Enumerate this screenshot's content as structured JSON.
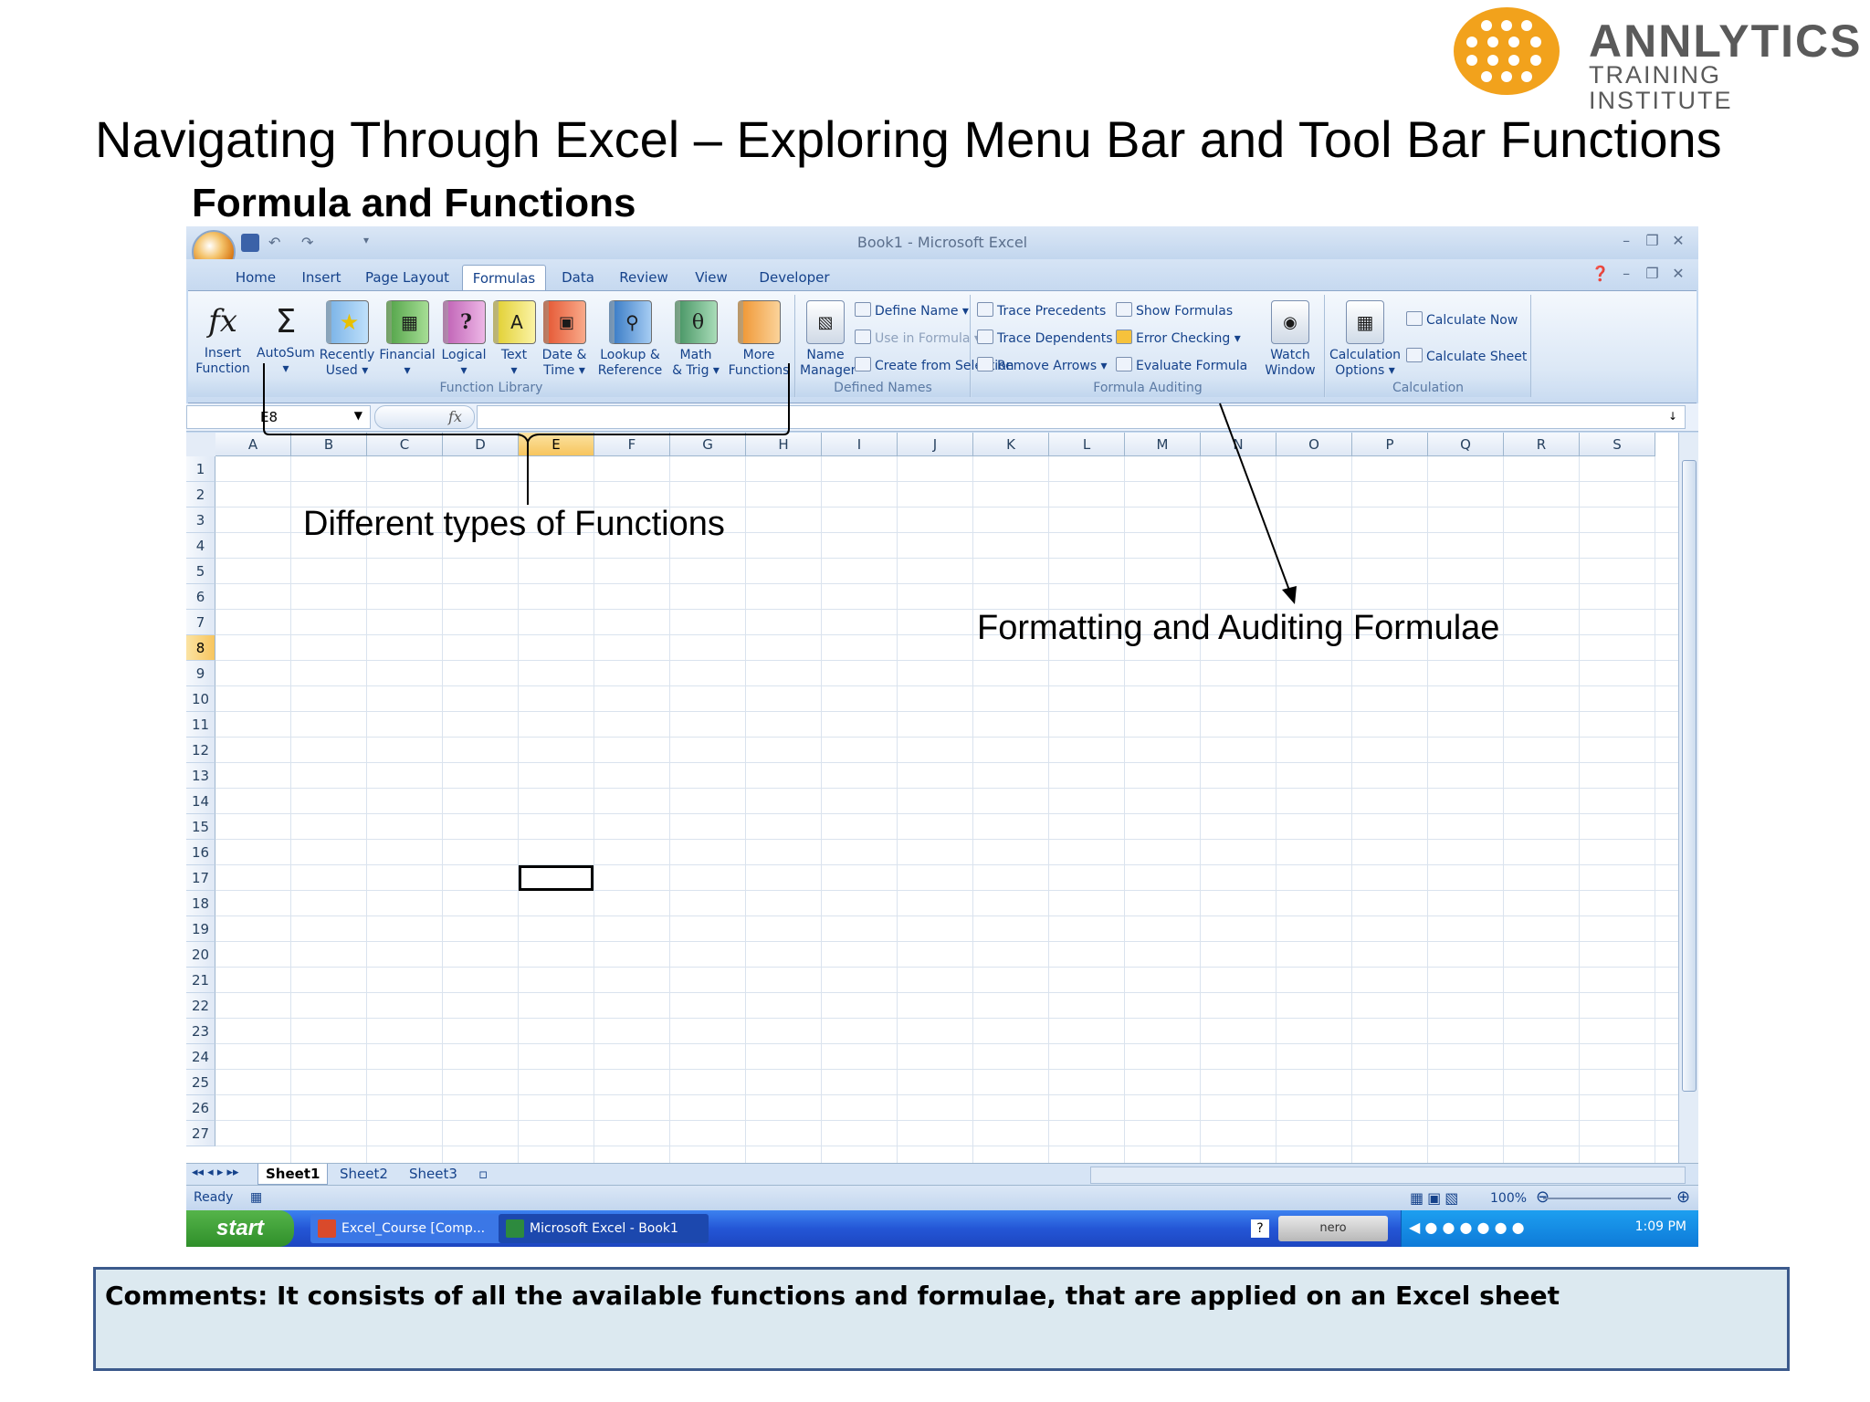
{
  "logo": {
    "name": "ANNLYTICS",
    "tagline": "TRAINING INSTITUTE",
    "colors": {
      "mark": "#f2a21c",
      "text": "#5a5a5a"
    }
  },
  "slide": {
    "title": "Navigating Through Excel – Exploring Menu Bar and Tool Bar Functions",
    "subtitle": "Formula and Functions"
  },
  "excel": {
    "window_title": "Book1 - Microsoft Excel",
    "tabs": [
      "Home",
      "Insert",
      "Page Layout",
      "Formulas",
      "Data",
      "Review",
      "View",
      "Developer"
    ],
    "active_tab": "Formulas",
    "ribbon": {
      "function_library": {
        "label": "Function Library",
        "buttons": [
          {
            "line1": "Insert",
            "line2": "Function",
            "icon": "fx-icon"
          },
          {
            "line1": "AutoSum",
            "line2": "▾",
            "icon": "sigma-icon"
          },
          {
            "line1": "Recently",
            "line2": "Used ▾",
            "icon": "book-star-icon"
          },
          {
            "line1": "Financial",
            "line2": "▾",
            "icon": "book-financial-icon"
          },
          {
            "line1": "Logical",
            "line2": "▾",
            "icon": "book-question-icon"
          },
          {
            "line1": "Text",
            "line2": "▾",
            "icon": "book-text-icon"
          },
          {
            "line1": "Date &",
            "line2": "Time ▾",
            "icon": "book-date-icon"
          },
          {
            "line1": "Lookup &",
            "line2": "Reference ▾",
            "icon": "book-lookup-icon"
          },
          {
            "line1": "Math",
            "line2": "& Trig ▾",
            "icon": "book-theta-icon"
          },
          {
            "line1": "More",
            "line2": "Functions ▾",
            "icon": "books-more-icon"
          }
        ]
      },
      "defined_names": {
        "label": "Defined Names",
        "name_manager": {
          "line1": "Name",
          "line2": "Manager"
        },
        "items": [
          "Define Name ▾",
          "Use in Formula ▾",
          "Create from Selection"
        ]
      },
      "formula_auditing": {
        "label": "Formula Auditing",
        "items_left": [
          "Trace Precedents",
          "Trace Dependents",
          "Remove Arrows ▾"
        ],
        "items_right": [
          "Show Formulas",
          "Error Checking ▾",
          "Evaluate Formula"
        ],
        "watch_window": {
          "line1": "Watch",
          "line2": "Window"
        }
      },
      "calculation": {
        "label": "Calculation",
        "options": {
          "line1": "Calculation",
          "line2": "Options ▾"
        },
        "items": [
          "Calculate Now",
          "Calculate Sheet"
        ]
      }
    },
    "name_box": "E8",
    "fx_label": "fx",
    "columns": [
      "A",
      "B",
      "C",
      "D",
      "E",
      "F",
      "G",
      "H",
      "I",
      "J",
      "K",
      "L",
      "M",
      "N",
      "O",
      "P",
      "Q",
      "R",
      "S"
    ],
    "selected_column": "E",
    "rows": [
      1,
      2,
      3,
      4,
      5,
      6,
      7,
      8,
      9,
      10,
      11,
      12,
      13,
      14,
      15,
      16,
      17,
      18,
      19,
      20,
      21,
      22,
      23,
      24,
      25,
      26,
      27
    ],
    "selected_row": 8,
    "sheet_nav": "◂◂ ◂ ▸ ▸▸",
    "sheets": [
      "Sheet1",
      "Sheet2",
      "Sheet3"
    ],
    "active_sheet": "Sheet1",
    "status": "Ready",
    "zoom": "100%"
  },
  "taskbar": {
    "start": "start",
    "items": [
      "Excel_Course [Comp...",
      "Microsoft Excel - Book1"
    ],
    "tray_label": "nero",
    "clock": "1:09 PM"
  },
  "annotations": {
    "functions": "Different types of Functions",
    "auditing": "Formatting and Auditing Formulae"
  },
  "comments": "Comments: It consists of all the available functions and formulae, that are applied on an Excel sheet"
}
